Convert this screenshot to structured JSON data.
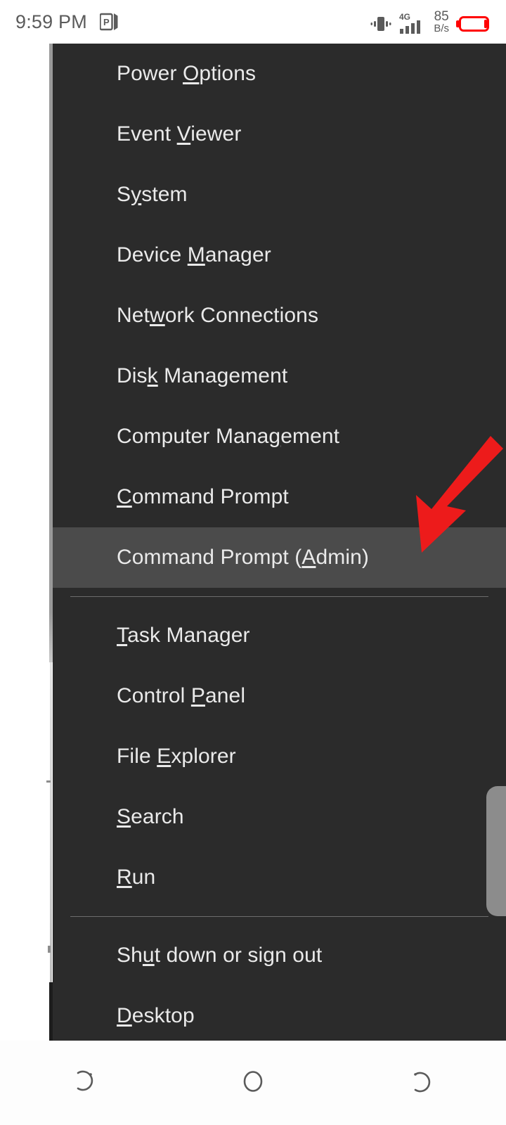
{
  "statusbar": {
    "clock": "9:59 PM",
    "app_icon_name": "powerpoint-icon",
    "vibrate_icon_name": "vibrate-icon",
    "signal_icon_name": "signal-bars-icon",
    "network_type": "4G",
    "net_speed_value": "85",
    "net_speed_unit": "B/s",
    "battery_icon_name": "battery-low-icon",
    "battery_color": "#FF0000"
  },
  "menu": {
    "name": "win-x-quick-link-menu",
    "background_color": "#2b2b2b",
    "highlight_color": "#4b4b4b",
    "text_color": "#eaeaea",
    "items": [
      {
        "id": "power-options",
        "pre": "Power ",
        "accel": "O",
        "post": "ptions",
        "selected": false,
        "sep_after": false
      },
      {
        "id": "event-viewer",
        "pre": "Event ",
        "accel": "V",
        "post": "iewer",
        "selected": false,
        "sep_after": false
      },
      {
        "id": "system",
        "pre": "S",
        "accel": "y",
        "post": "stem",
        "selected": false,
        "sep_after": false
      },
      {
        "id": "device-manager",
        "pre": "Device ",
        "accel": "M",
        "post": "anager",
        "selected": false,
        "sep_after": false
      },
      {
        "id": "network-connections",
        "pre": "Net",
        "accel": "w",
        "post": "ork Connections",
        "selected": false,
        "sep_after": false
      },
      {
        "id": "disk-management",
        "pre": "Dis",
        "accel": "k",
        "post": " Management",
        "selected": false,
        "sep_after": false
      },
      {
        "id": "computer-management",
        "pre": "Computer Mana",
        "accel": "g",
        "post": "ement",
        "selected": false,
        "sep_after": false
      },
      {
        "id": "command-prompt",
        "pre": "",
        "accel": "C",
        "post": "ommand Prompt",
        "selected": false,
        "sep_after": false
      },
      {
        "id": "command-prompt-admin",
        "pre": "Command Prompt (",
        "accel": "A",
        "post": "dmin)",
        "selected": true,
        "sep_after": true
      },
      {
        "id": "task-manager",
        "pre": "",
        "accel": "T",
        "post": "ask Manager",
        "selected": false,
        "sep_after": false
      },
      {
        "id": "control-panel",
        "pre": "Control ",
        "accel": "P",
        "post": "anel",
        "selected": false,
        "sep_after": false
      },
      {
        "id": "file-explorer",
        "pre": "File ",
        "accel": "E",
        "post": "xplorer",
        "selected": false,
        "sep_after": false
      },
      {
        "id": "search",
        "pre": "",
        "accel": "S",
        "post": "earch",
        "selected": false,
        "sep_after": false
      },
      {
        "id": "run",
        "pre": "",
        "accel": "R",
        "post": "un",
        "selected": false,
        "sep_after": true
      },
      {
        "id": "shut-down-or-sign-out",
        "pre": "Sh",
        "accel": "u",
        "post": "t down or sign out",
        "selected": false,
        "sep_after": false
      },
      {
        "id": "desktop",
        "pre": "",
        "accel": "D",
        "post": "esktop",
        "selected": false,
        "sep_after": false
      }
    ]
  },
  "annotation": {
    "arrow_name": "red-pointer-arrow",
    "color": "#ED1B1B",
    "points_to": "command-prompt-admin"
  },
  "scrollbar": {
    "name": "vertical-scroll-handle",
    "color": "#8c8c8c"
  },
  "navbar": {
    "buttons": [
      {
        "id": "recents",
        "icon": "recents-icon"
      },
      {
        "id": "home",
        "icon": "home-circle-icon"
      },
      {
        "id": "back",
        "icon": "back-icon"
      }
    ],
    "icon_color": "#5b5b5b"
  }
}
